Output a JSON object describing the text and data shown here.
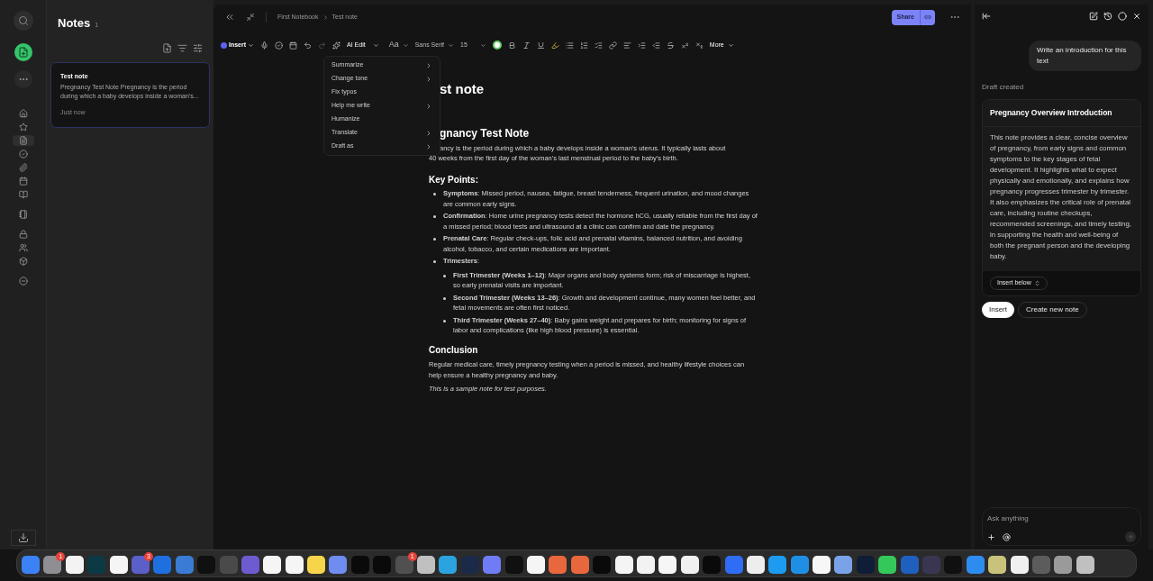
{
  "rail": {
    "items": [
      {
        "kind": "home",
        "selected": false
      },
      {
        "kind": "star",
        "selected": false
      },
      {
        "kind": "notes",
        "selected": true
      },
      {
        "kind": "tasks",
        "selected": false
      },
      {
        "kind": "attachments",
        "selected": false
      },
      {
        "kind": "calendar",
        "selected": false
      },
      {
        "kind": "book",
        "selected": false
      },
      {
        "kind": "notebook",
        "selected": false
      },
      {
        "kind": "locked",
        "selected": false
      },
      {
        "kind": "people",
        "selected": false
      },
      {
        "kind": "box",
        "selected": false
      },
      {
        "kind": "minus",
        "selected": false
      }
    ]
  },
  "notes_list": {
    "title": "Notes",
    "count": "1",
    "notes": [
      {
        "title": "Test note",
        "preview": "Pregnancy Test Note Pregnancy is the period during which a baby develops inside a woman's...",
        "time": "Just now",
        "selected": true
      }
    ]
  },
  "editor": {
    "breadcrumb": [
      "First Notebook",
      "Test note"
    ],
    "share": "Share",
    "toolbar": {
      "insert": "Insert",
      "ai_edit": "AI Edit",
      "font_size_icon": "Aa",
      "font": "Sans Serif",
      "size": "15",
      "more": "More"
    },
    "ai_menu": [
      {
        "label": "Summarize",
        "submenu": true
      },
      {
        "label": "Change tone",
        "submenu": true
      },
      {
        "label": "Fix typos",
        "submenu": false
      },
      {
        "label": "Help me write",
        "submenu": true
      },
      {
        "label": "Humanize",
        "submenu": false
      },
      {
        "label": "Translate",
        "submenu": true
      },
      {
        "label": "Draft as",
        "submenu": true
      }
    ],
    "title": "st note",
    "heading": "gnancy Test Note",
    "intro_cut": "ancy is the period during which a baby develops inside a woman's uterus. It typically lasts about",
    "intro_rest": "40 weeks from the first day of the woman's last menstrual period to the baby's birth.",
    "key_points_heading": "Key Points:",
    "key_points": [
      {
        "text": "**Symptoms**: Missed period, nausea, fatigue, breast tenderness, frequent urination, and mood changes are common early signs."
      },
      {
        "text": "**Confirmation**: Home urine pregnancy tests detect the hormone hCG, usually reliable from the first day of a missed period; blood tests and ultrasound at a clinic can confirm and date the pregnancy."
      },
      {
        "text": "**Prenatal Care**: Regular check-ups, folic acid and prenatal vitamins, balanced nutrition, and avoiding alcohol, tobacco, and certain medications are important."
      },
      {
        "text": "**Trimesters**:",
        "children": [
          {
            "text": "**First Trimester (Weeks 1–12)**: Major organs and body systems form; risk of miscarriage is highest, so early prenatal visits are important."
          },
          {
            "text": "**Second Trimester (Weeks 13–26)**: Growth and development continue, many women feel better, and fetal movements are often first noticed."
          },
          {
            "text": "**Third Trimester (Weeks 27–40)**: Baby gains weight and prepares for birth; monitoring for signs of labor and complications (like high blood pressure) is essential."
          }
        ]
      }
    ],
    "conclusion_heading": "Conclusion",
    "conclusion": "Regular medical care, timely pregnancy testing when a period is missed, and healthy lifestyle choices can help ensure a healthy pregnancy and baby.",
    "footnote": "This is a sample note for test purposes."
  },
  "assistant": {
    "prompt": "Write an introduction for this text",
    "status": "Draft created",
    "draft_title": "Pregnancy Overview Introduction",
    "draft_body": "This note provides a clear, concise overview of pregnancy, from early signs and common symptoms to the key stages of fetal development. It highlights what to expect physically and emotionally, and explains how pregnancy progresses trimester by trimester. It also emphasizes the critical role of prenatal care, including routine checkups, recommended screenings, and timely testing, in supporting the health and well-being of both the pregnant person and the developing baby.",
    "position": "Insert below",
    "insert": "Insert",
    "create": "Create new note",
    "input_placeholder": "Ask anything"
  },
  "dock": {
    "apps": [
      {
        "color": "#3b82f6"
      },
      {
        "color": "#8e8e93",
        "badge": "1"
      },
      {
        "color": "#f3f3f3"
      },
      {
        "color": "#0b3a45"
      },
      {
        "color": "#f5f5f5"
      },
      {
        "color": "#5b5fc7",
        "badge": "3"
      },
      {
        "color": "#1e6fe0"
      },
      {
        "color": "#3a7bd5"
      },
      {
        "color": "#101010"
      },
      {
        "color": "#4a4a4a"
      },
      {
        "color": "#6d5bd0"
      },
      {
        "color": "#f5f5f5"
      },
      {
        "color": "#f5f5f5"
      },
      {
        "color": "#f6d54a"
      },
      {
        "color": "#6f8cf0"
      },
      {
        "color": "#0a0a0a"
      },
      {
        "color": "#0a0a0a"
      },
      {
        "color": "#505050",
        "badge": "1"
      },
      {
        "color": "#c0c0c0"
      },
      {
        "color": "#2aa3e0"
      },
      {
        "color": "#1c2a4a"
      },
      {
        "color": "#6f7cf5"
      },
      {
        "color": "#101010"
      },
      {
        "color": "#f5f5f5"
      },
      {
        "color": "#e8673c"
      },
      {
        "color": "#e8673c"
      },
      {
        "color": "#0a0a0a"
      },
      {
        "color": "#f4f4f4"
      },
      {
        "color": "#f2f2f2"
      },
      {
        "color": "#f6f6f6"
      },
      {
        "color": "#f0f0f0"
      },
      {
        "color": "#0a0a0a"
      },
      {
        "color": "#2f6df6"
      },
      {
        "color": "#ededed"
      },
      {
        "color": "#1d9bf0"
      },
      {
        "color": "#1f8fe6"
      },
      {
        "color": "#f7f7f7"
      },
      {
        "color": "#7aa2e8"
      },
      {
        "color": "#0f1e36"
      },
      {
        "color": "#34c759"
      },
      {
        "color": "#1f5fbf"
      },
      {
        "color": "#3a3550"
      },
      {
        "color": "#101010"
      },
      {
        "color": "#2d8cf0"
      },
      {
        "color": "#c9c27a"
      },
      {
        "color": "#f0f0f0"
      },
      {
        "color": "#5c5c5c"
      },
      {
        "color": "#9a9a9a"
      },
      {
        "color": "#c0c0c0"
      }
    ]
  }
}
